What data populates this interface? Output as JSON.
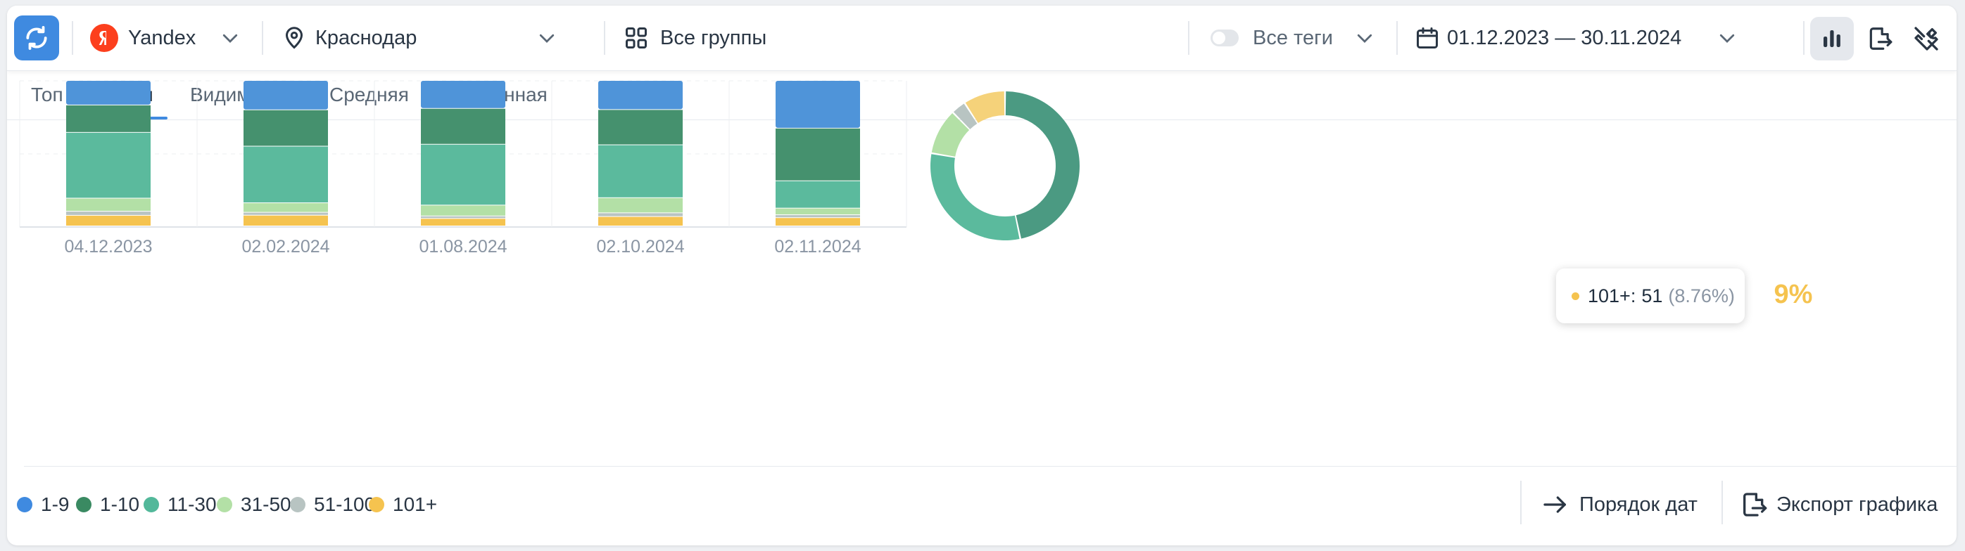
{
  "toolbar": {
    "engine": "Yandex",
    "city": "Краснодар",
    "groups": "Все группы",
    "tags": "Все теги",
    "date_range": "01.12.2023 — 30.11.2024"
  },
  "tabs": [
    {
      "label": "Топ %",
      "active": false
    },
    {
      "label": "Топ",
      "active": true
    },
    {
      "label": "Видимость",
      "active": false
    },
    {
      "label": "Средняя",
      "active": false
    },
    {
      "label": "Медианная",
      "active": false
    }
  ],
  "colors": {
    "accent": "#3f8ae0",
    "1-9": "#4f94d9",
    "1-10": "#45916e",
    "11-30": "#5bba9d",
    "31-50": "#b3e0a6",
    "51-100": "#b8c4c2",
    "101+": "#f5c34f"
  },
  "chart_data": {
    "type": "bar",
    "stacked": true,
    "categories": [
      "04.12.2023",
      "02.02.2024",
      "01.08.2024",
      "02.10.2024",
      "02.11.2024"
    ],
    "series": [
      {
        "name": "1-9",
        "values": [
          60,
          71,
          67,
          71,
          115
        ]
      },
      {
        "name": "1-10",
        "values": [
          67,
          88,
          86,
          86,
          127
        ]
      },
      {
        "name": "11-30",
        "values": [
          161,
          137,
          146,
          129,
          66
        ]
      },
      {
        "name": "31-50",
        "values": [
          32,
          23,
          26,
          37,
          16
        ]
      },
      {
        "name": "51-100",
        "values": [
          10,
          7,
          6,
          9,
          7
        ]
      },
      {
        "name": "101+",
        "values": [
          26,
          26,
          18,
          23,
          20
        ]
      }
    ],
    "grid": true,
    "legend_position": "bottom-left",
    "donut": {
      "slices": [
        {
          "name": "1-9",
          "value": 0
        },
        {
          "name": "1-10",
          "value": 262
        },
        {
          "name": "11-30",
          "value": 174
        },
        {
          "name": "31-50",
          "value": 56
        },
        {
          "name": "51-100",
          "value": 18
        },
        {
          "name": "101+",
          "value": 51
        }
      ],
      "center_label": "9%",
      "tooltip": {
        "series": "101+",
        "label": "101+:",
        "value": "51",
        "percent": "(8.76%)"
      }
    }
  },
  "legend": [
    {
      "label": "1-9",
      "color": "#3f8ae0"
    },
    {
      "label": "1-10",
      "color": "#3a8a62"
    },
    {
      "label": "11-30",
      "color": "#52b89a"
    },
    {
      "label": "31-50",
      "color": "#b3e0a6"
    },
    {
      "label": "51-100",
      "color": "#b8c4c2"
    },
    {
      "label": "101+",
      "color": "#f5c34f"
    }
  ],
  "actions": {
    "date_order": "Порядок дат",
    "export": "Экспорт графика"
  }
}
